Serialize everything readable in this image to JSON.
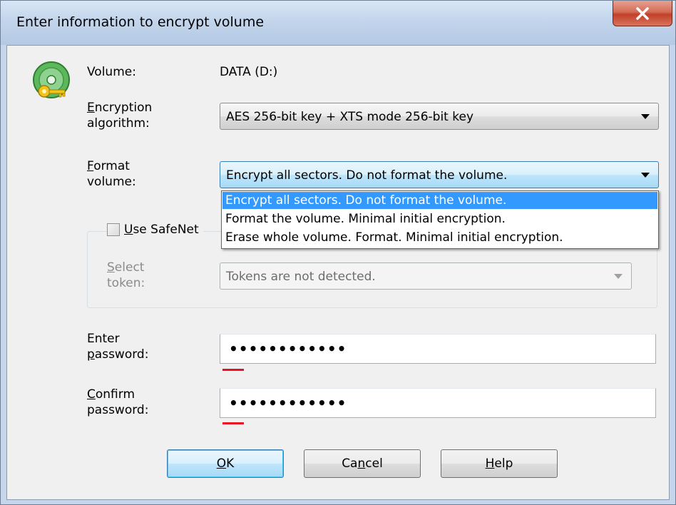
{
  "window": {
    "title": "Enter information to encrypt volume"
  },
  "volume": {
    "label": "Volume:",
    "value": "DATA (D:)"
  },
  "encryption": {
    "label_line1_first": "E",
    "label_line1_rest": "ncryption",
    "label_line2": "algorithm:",
    "selected": "AES 256-bit key + XTS mode 256-bit key"
  },
  "format": {
    "label_line1_first": "F",
    "label_line1_rest": "ormat",
    "label_line2": "volume:",
    "selected": "Encrypt all sectors. Do not format the volume.",
    "options": [
      "Encrypt all sectors. Do not format the volume.",
      "Format the volume. Minimal initial encryption.",
      "Erase whole volume. Format. Minimal initial encryption."
    ]
  },
  "safenet": {
    "checkbox_first": "U",
    "checkbox_rest": "se SafeNet",
    "token_label_line1_first": "S",
    "token_label_line1_rest": "elect",
    "token_label_line2": "token:",
    "token_value": "Tokens are not detected."
  },
  "password": {
    "label_line1": "Enter",
    "label_line2_first": "p",
    "label_line2_rest": "assword:",
    "value": "••••••••••••"
  },
  "confirm": {
    "label_line1_first": "C",
    "label_line1_rest": "onfirm",
    "label_line2": "password:",
    "value": "••••••••••••"
  },
  "buttons": {
    "ok_first": "O",
    "ok_rest": "K",
    "cancel_first": "Ca",
    "cancel_u": "n",
    "cancel_rest": "cel",
    "help_first": "H",
    "help_rest": "elp"
  },
  "colors": {
    "selection": "#3399ff",
    "error_mark": "#e81123",
    "title_bar": "#c3d5ec"
  }
}
